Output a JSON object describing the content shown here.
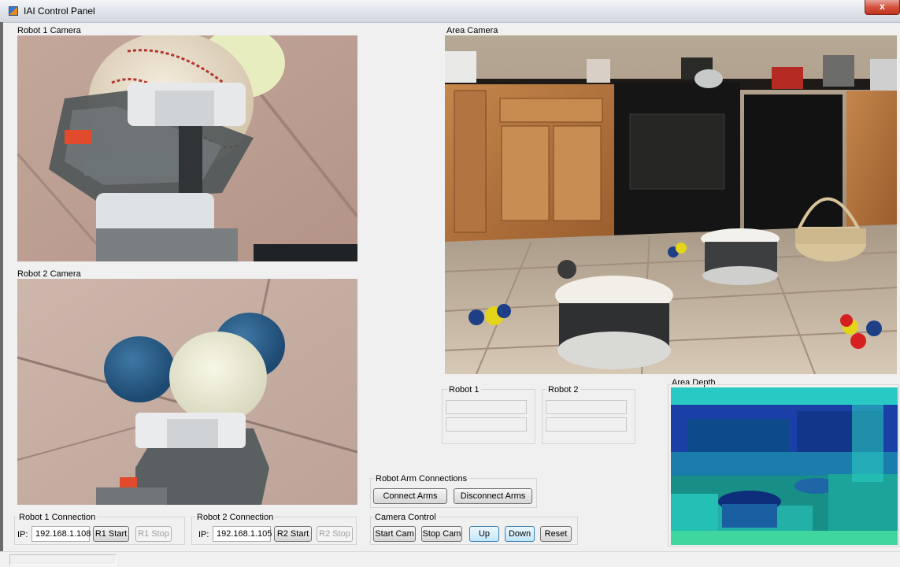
{
  "window": {
    "title": "IAI Control Panel",
    "close_glyph": "x"
  },
  "cameras": {
    "robot1_label": "Robot 1 Camera",
    "robot2_label": "Robot 2 Camera",
    "area_label": "Area Camera",
    "depth_label": "Area Depth"
  },
  "status": {
    "robot1_label": "Robot 1",
    "robot2_label": "Robot 2",
    "robot1_line1": "",
    "robot1_line2": "",
    "robot2_line1": "",
    "robot2_line2": ""
  },
  "robot1_connection": {
    "group_label": "Robot 1 Connection",
    "ip_label": "IP:",
    "ip_value": "192.168.1.108",
    "start_label": "R1 Start",
    "stop_label": "R1 Stop"
  },
  "robot2_connection": {
    "group_label": "Robot 2 Connection",
    "ip_label": "IP:",
    "ip_value": "192.168.1.105",
    "start_label": "R2 Start",
    "stop_label": "R2 Stop"
  },
  "arm_connections": {
    "group_label": "Robot Arm Connections",
    "connect_label": "Connect Arms",
    "disconnect_label": "Disconnect Arms"
  },
  "camera_control": {
    "group_label": "Camera Control",
    "start_label": "Start Cam",
    "stop_label": "Stop Cam",
    "up_label": "Up",
    "down_label": "Down",
    "reset_label": "Reset"
  },
  "colors": {
    "background": "#f0f0f0",
    "focus_border": "#3c7fb1",
    "depth_background": "#0a1f6b"
  }
}
